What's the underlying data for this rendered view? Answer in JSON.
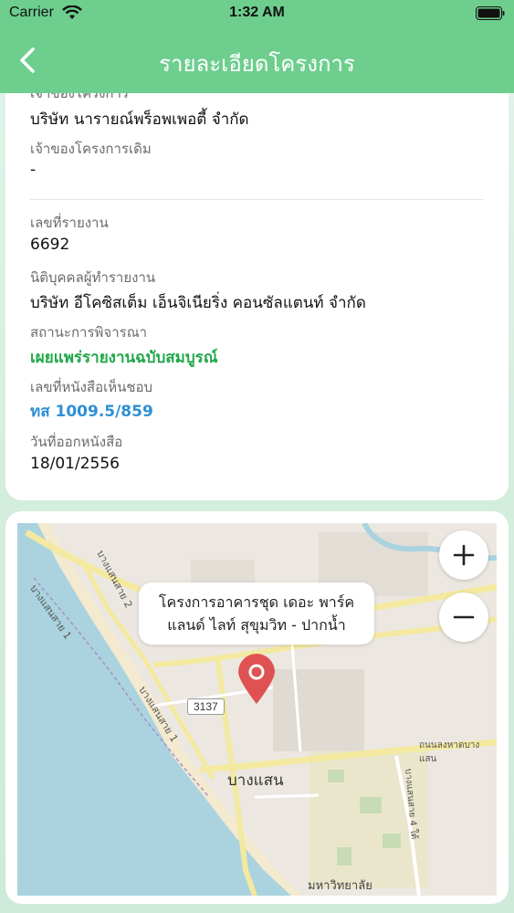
{
  "status_bar": {
    "carrier": "Carrier",
    "time": "1:32 AM"
  },
  "nav": {
    "title": "รายละเอียดโครงการ",
    "back_icon": "chevron-left-icon"
  },
  "details": {
    "owner_label_partial": "เจ้าของโครงการ",
    "owner_value": "บริษัท นารายณ์พร็อพเพอตี้ จำกัด",
    "former_owner_label": "เจ้าของโครงการเดิม",
    "former_owner_value": "-",
    "report_no_label": "เลขที่รายงาน",
    "report_no_value": "6692",
    "consultant_label": "นิติบุคคลผู้ทำรายงาน",
    "consultant_value": "บริษัท อีโคซิสเต็ม เอ็นจิเนียริ่ง คอนซัลแตนท์ จำกัด",
    "status_label": "สถานะการพิจารณา",
    "status_value": "เผยแพร่รายงานฉบับสมบูรณ์",
    "approval_no_label": "เลขที่หนังสือเห็นชอบ",
    "approval_no_value": "ทส 1009.5/859",
    "issue_date_label": "วันที่ออกหนังสือ",
    "issue_date_value": "18/01/2556"
  },
  "map": {
    "popup_line1": "โครงการอาคารชุด เดอะ พาร์ค",
    "popup_line2": "แลนด์ ไลท์ สุขุมวิท - ปากน้ำ",
    "place_label": "บางแสน",
    "road_shield": "3137",
    "road_bangsaen_sai1_top": "บางแสนสาย 1",
    "road_bangsaen_sai1_bottom": "บางแสนสาย 1",
    "road_bangsaen_sai2": "บางแสนสาย 2",
    "road_bangsaen_sai4": "บางแสนสาย 4 ใต้",
    "road_long_hat": "ถนนลงหาดบางแสน",
    "university_label": "มหาวิทยาลัย",
    "zoom_in_icon": "plus-icon",
    "zoom_out_icon": "minus-icon",
    "marker_color": "#e05252"
  },
  "colors": {
    "header": "#6dce8e",
    "status_green": "#21a74a",
    "link_blue": "#2f8fd3"
  }
}
